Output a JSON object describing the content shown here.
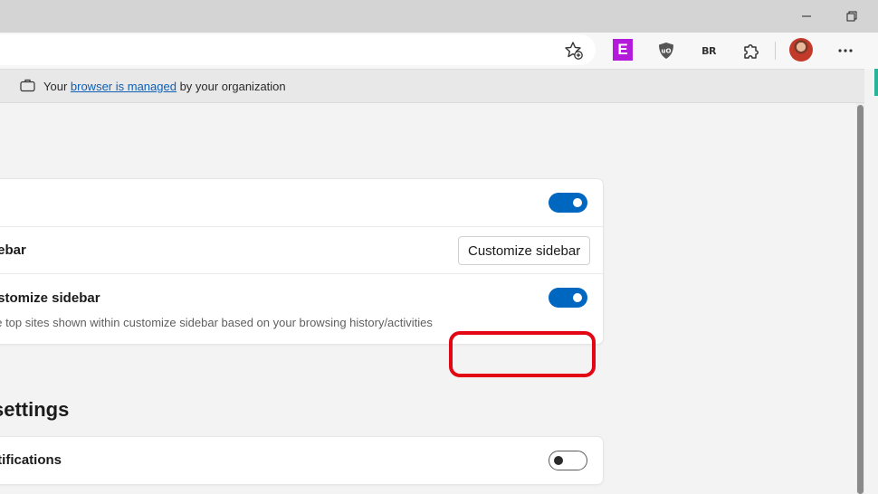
{
  "browser": {
    "window_controls": [
      "minimize",
      "restore"
    ],
    "toolbar": {
      "extensions": {
        "e_label": "E",
        "br_label": "BR"
      },
      "icons": [
        "favorites-star-icon",
        "e-extension-icon",
        "ublock-shield-icon",
        "br-extension-icon",
        "extensions-puzzle-icon",
        "profile-avatar",
        "more-icon"
      ]
    },
    "managed_banner": {
      "prefix": "Your ",
      "link": "browser is managed",
      "suffix": " by your organization"
    }
  },
  "settings": {
    "sidebar_card": {
      "row2_title": "debar",
      "customize_button": "Customize sidebar",
      "row3_title": "ustomize sidebar",
      "row3_desc": "he top sites shown within customize sidebar based on your browsing history/activities",
      "toggle1_on": true,
      "toggle3_on": true
    },
    "section_title": "settings",
    "notifications_card": {
      "title": "otifications",
      "toggle_on": false
    }
  },
  "colors": {
    "accent": "#0067c0",
    "highlight_ring": "#e30613",
    "link": "#0f5fb5",
    "extension_e": "#b41ad9"
  }
}
